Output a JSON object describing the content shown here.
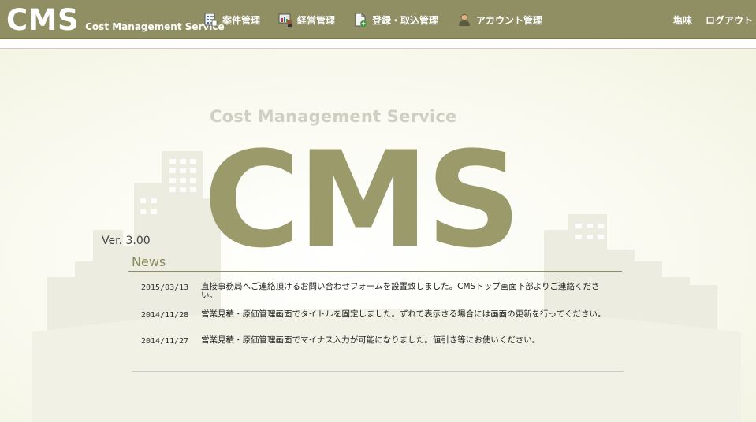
{
  "header": {
    "brand_logo": "CMS",
    "brand_sub": "Cost Management Service",
    "nav": [
      {
        "label": "案件管理",
        "icon": "document-list-icon"
      },
      {
        "label": "経営管理",
        "icon": "presentation-chart-icon"
      },
      {
        "label": "登録・取込管理",
        "icon": "document-add-icon"
      },
      {
        "label": "アカウント管理",
        "icon": "user-account-icon"
      }
    ],
    "user_name": "塩味",
    "logout_label": "ログアウト",
    "bar_color": "#8f8f63"
  },
  "hero": {
    "subtitle": "Cost Management Service",
    "logo": "CMS",
    "version": "Ver. 3.00",
    "logo_color": "#9a9a6b"
  },
  "news": {
    "title": "News",
    "items": [
      {
        "date": "2015/03/13",
        "text": "直接事務局へご連絡頂けるお問い合わせフォームを設置致しました。CMSトップ画面下部よりご連絡ください。"
      },
      {
        "date": "2014/11/28",
        "text": "営業見積・原価管理画面でタイトルを固定しました。ずれて表示さる場合には画面の更新を行ってください。"
      },
      {
        "date": "2014/11/27",
        "text": "営業見積・原価管理画面でマイナス入力が可能になりました。値引き等にお使いください。"
      }
    ]
  }
}
